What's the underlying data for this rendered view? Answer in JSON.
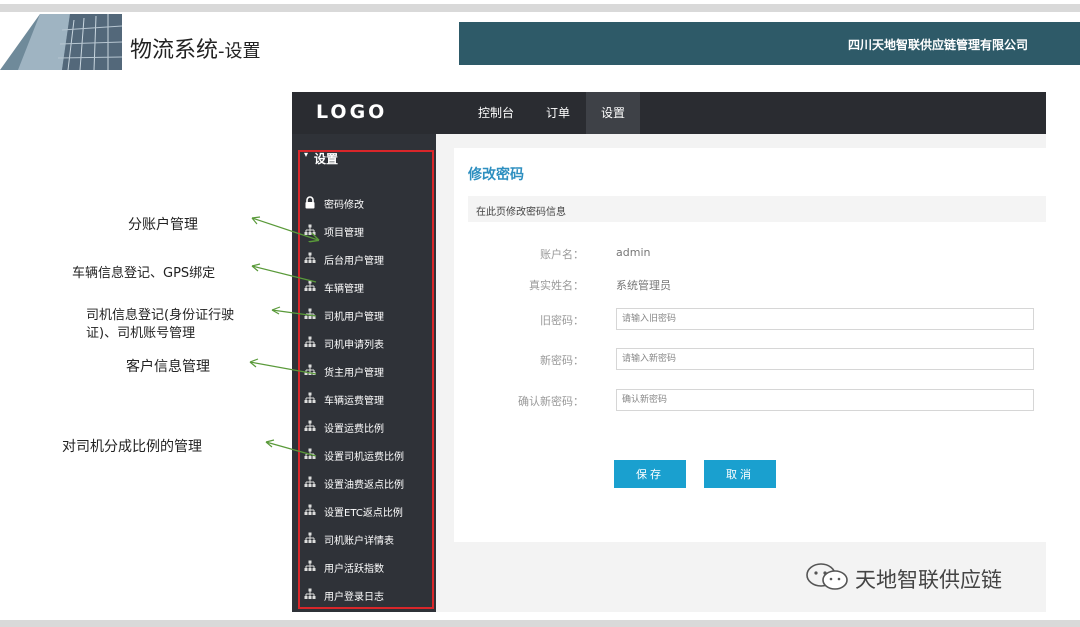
{
  "slide": {
    "title": "物流系统",
    "title_suffix": "-设置",
    "company": "四川天地智联供应链管理有限公司"
  },
  "app": {
    "logo": "LOGO",
    "nav": [
      "控制台",
      "订单",
      "设置"
    ],
    "active_nav": "设置",
    "sidebar": {
      "section": "设置",
      "items": [
        {
          "label": "密码修改",
          "icon": "lock-icon"
        },
        {
          "label": "项目管理",
          "icon": "org-icon"
        },
        {
          "label": "后台用户管理",
          "icon": "org-icon"
        },
        {
          "label": "车辆管理",
          "icon": "org-icon"
        },
        {
          "label": "司机用户管理",
          "icon": "org-icon"
        },
        {
          "label": "司机申请列表",
          "icon": "org-icon"
        },
        {
          "label": "货主用户管理",
          "icon": "org-icon"
        },
        {
          "label": "车辆运费管理",
          "icon": "org-icon"
        },
        {
          "label": "设置运费比例",
          "icon": "org-icon"
        },
        {
          "label": "设置司机运费比例",
          "icon": "org-icon"
        },
        {
          "label": "设置油费返点比例",
          "icon": "org-icon"
        },
        {
          "label": "设置ETC返点比例",
          "icon": "org-icon"
        },
        {
          "label": "司机账户详情表",
          "icon": "org-icon"
        },
        {
          "label": "用户活跃指数",
          "icon": "org-icon"
        },
        {
          "label": "用户登录日志",
          "icon": "org-icon"
        }
      ]
    },
    "content": {
      "title": "修改密码",
      "subtitle": "在此页修改密码信息",
      "account_label": "账户名：",
      "account_value": "admin",
      "realname_label": "真实姓名：",
      "realname_value": "系统管理员",
      "old_pwd_label": "旧密码：",
      "old_pwd_placeholder": "请输入旧密码",
      "new_pwd_label": "新密码：",
      "new_pwd_placeholder": "请输入新密码",
      "confirm_pwd_label": "确认新密码：",
      "confirm_pwd_placeholder": "确认新密码",
      "save": "保存",
      "cancel": "取消"
    }
  },
  "annotations": [
    "分账户管理",
    "车辆信息登记、GPS绑定",
    "司机信息登记(身份证行驶",
    "证)、司机账号管理",
    "客户信息管理",
    "对司机分成比例的管理"
  ],
  "watermark": "天地智联供应链",
  "colors": {
    "header_dark": "#2a2c31",
    "sidebar": "#2f3238",
    "accent_blue": "#1aa0cf",
    "title_blue": "#2e8fc0",
    "company_bar": "#2e5a68",
    "highlight_red": "#d9262a",
    "arrow_green": "#5a9a3a"
  }
}
